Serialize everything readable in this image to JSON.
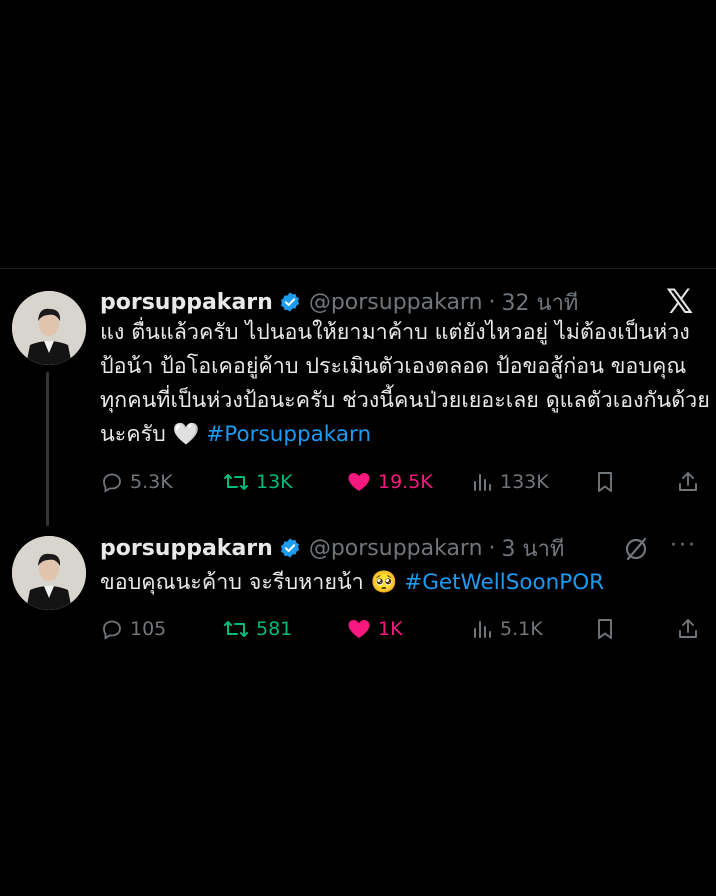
{
  "tweets": [
    {
      "name": "porsuppakarn",
      "handle": "@porsuppakarn",
      "time": "32 นาที",
      "body_text": "แง ตื่นแล้วครับ ไปนอนให้ยามาค้าบ แต่ยังไหวอยู่ ไม่ต้องเป็นห่วงป้อน้า ป้อโอเคอยู่ค้าบ  ประเมินตัวเองตลอด ป้อขอสู้ก่อน ขอบคุณทุกคนที่เป็นห่วงป้อนะครับ ช่วงนี้คนป่วยเยอะเลย ดูแลตัวเองกันด้วยนะครับ",
      "emoji": "🤍",
      "hashtag": "#Porsuppakarn",
      "replies": "5.3K",
      "retweets": "13K",
      "likes": "19.5K",
      "views": "133K"
    },
    {
      "name": "porsuppakarn",
      "handle": "@porsuppakarn",
      "time": "3 นาที",
      "body_text": "ขอบคุณนะค้าบ จะรีบหายน้า",
      "emoji": "🥺",
      "hashtag": "#GetWellSoonPOR",
      "replies": "105",
      "retweets": "581",
      "likes": "1K",
      "views": "5.1K"
    }
  ],
  "brand": {
    "logo": "𝕏"
  },
  "more_label": "···",
  "icons": [
    "verified-badge-icon",
    "reply-icon",
    "retweet-icon",
    "like-icon",
    "views-icon",
    "bookmark-icon",
    "share-icon",
    "x-logo-icon",
    "grok-icon",
    "more-icon"
  ],
  "colors": {
    "background": "#000000",
    "text": "#e7e9ea",
    "muted": "#71767b",
    "link": "#1d9bf0",
    "retweet": "#00ba7c",
    "like": "#f91880",
    "verified": "#1d9bf0"
  }
}
